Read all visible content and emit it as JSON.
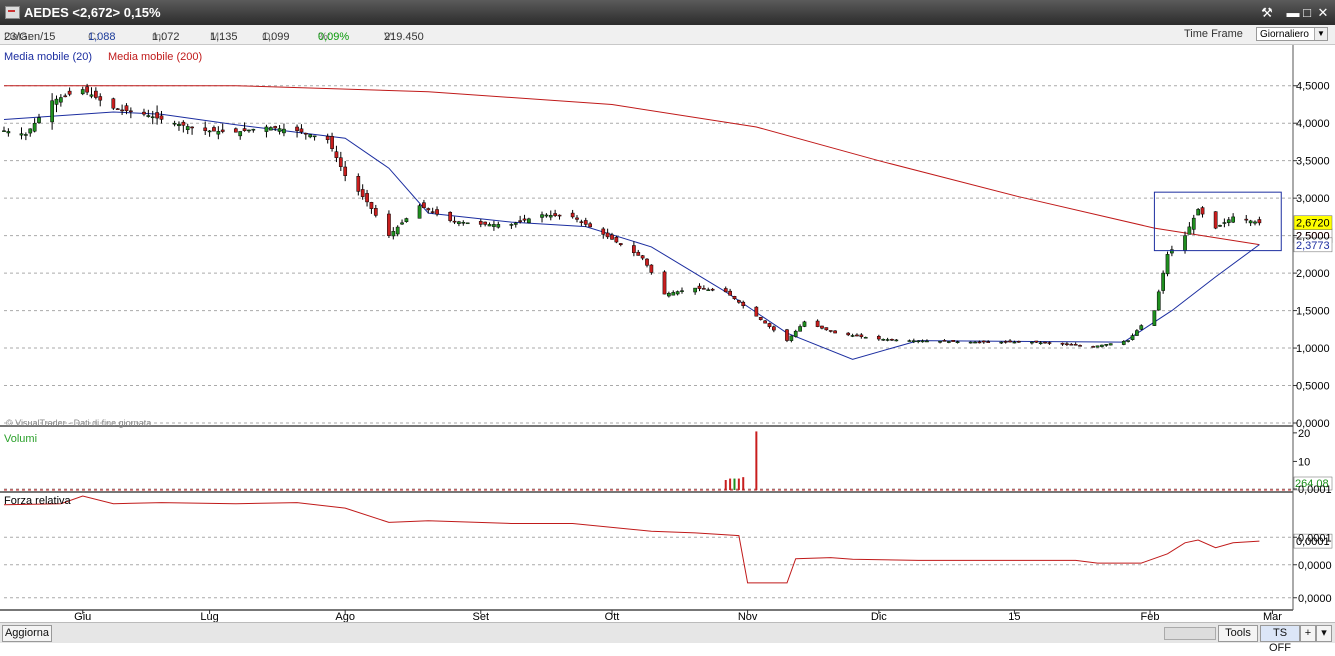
{
  "window": {
    "title": "AEDES <2,672> 0,15%"
  },
  "info": {
    "data_label": "Data:",
    "data_value": "23/Gen/15",
    "c_label": "C:",
    "c_value": "1,088",
    "m_label": "m:",
    "m_value": "1,072",
    "M_label": "M:",
    "M_value": "1,135",
    "o_label": "O:",
    "o_value": "1,099",
    "pct_label": "%:",
    "pct_value": "0,09%",
    "v_label": "V:",
    "v_value": "219.450",
    "timeframe_label": "Time Frame",
    "timeframe_value": "Giornaliero"
  },
  "bottom": {
    "aggiorna": "Aggiorna",
    "tools": "Tools",
    "ts_off": "TS OFF",
    "plus": "+",
    "menu": "▾"
  },
  "colors": {
    "up": "#1f8f1f",
    "down": "#c81e1e",
    "ma20": "#1c2ea0",
    "ma200": "#c01a1a",
    "price_badge": "#ffff00"
  },
  "chart_data": [
    {
      "type": "candlestick",
      "legend": [
        "Media mobile (20)",
        "Media mobile (200)"
      ],
      "watermark": "© VisualTrader - Dati di fine giornata",
      "x_labels": [
        "Giu",
        "Lug",
        "Ago",
        "Set",
        "Ott",
        "Nov",
        "Dic",
        "15",
        "Feb",
        "Mar"
      ],
      "y_ticks": [
        "0,0000",
        "0,5000",
        "1,0000",
        "1,5000",
        "2,0000",
        "2,5000",
        "3,0000",
        "3,5000",
        "4,0000",
        "4,5000"
      ],
      "ylim": [
        0,
        4.75
      ],
      "last_price": "2,6720",
      "ma200_last": "2,5000",
      "ma20_last": "2,3773",
      "x_start": "2014-05-15",
      "x_end": "2015-03-05",
      "close_path": [
        [
          "2014-05-15",
          3.9
        ],
        [
          "2014-05-20",
          3.85
        ],
        [
          "2014-05-26",
          4.3
        ],
        [
          "2014-06-02",
          4.45
        ],
        [
          "2014-06-09",
          4.2
        ],
        [
          "2014-06-16",
          4.12
        ],
        [
          "2014-06-23",
          4.0
        ],
        [
          "2014-06-30",
          3.9
        ],
        [
          "2014-07-07",
          3.88
        ],
        [
          "2014-07-14",
          3.95
        ],
        [
          "2014-07-21",
          3.9
        ],
        [
          "2014-07-28",
          3.78
        ],
        [
          "2014-08-01",
          3.3
        ],
        [
          "2014-08-06",
          2.95
        ],
        [
          "2014-08-11",
          2.5
        ],
        [
          "2014-08-18",
          2.9
        ],
        [
          "2014-08-25",
          2.7
        ],
        [
          "2014-09-01",
          2.65
        ],
        [
          "2014-09-08",
          2.65
        ],
        [
          "2014-09-15",
          2.78
        ],
        [
          "2014-09-22",
          2.75
        ],
        [
          "2014-10-01",
          2.45
        ],
        [
          "2014-10-08",
          2.2
        ],
        [
          "2014-10-13",
          1.72
        ],
        [
          "2014-10-20",
          1.8
        ],
        [
          "2014-10-27",
          1.75
        ],
        [
          "2014-11-10",
          1.1
        ],
        [
          "2014-11-14",
          1.35
        ],
        [
          "2014-11-21",
          1.2
        ],
        [
          "2014-12-01",
          1.12
        ],
        [
          "2014-12-08",
          1.1
        ],
        [
          "2014-12-22",
          1.08
        ],
        [
          "2015-01-05",
          1.08
        ],
        [
          "2015-01-19",
          1.02
        ],
        [
          "2015-01-27",
          1.1
        ],
        [
          "2015-02-02",
          1.5
        ],
        [
          "2015-02-05",
          2.25
        ],
        [
          "2015-02-09",
          2.5
        ],
        [
          "2015-02-12",
          2.85
        ],
        [
          "2015-02-16",
          2.6
        ],
        [
          "2015-02-20",
          2.75
        ],
        [
          "2015-02-26",
          2.67
        ]
      ],
      "ma20": [
        [
          "2014-05-15",
          4.05
        ],
        [
          "2014-06-09",
          4.15
        ],
        [
          "2014-06-20",
          4.12
        ],
        [
          "2014-07-07",
          3.98
        ],
        [
          "2014-08-01",
          3.8
        ],
        [
          "2014-08-11",
          3.4
        ],
        [
          "2014-08-20",
          2.8
        ],
        [
          "2014-09-08",
          2.68
        ],
        [
          "2014-09-25",
          2.62
        ],
        [
          "2014-10-10",
          2.35
        ],
        [
          "2014-10-27",
          1.75
        ],
        [
          "2014-11-10",
          1.2
        ],
        [
          "2014-11-25",
          0.85
        ],
        [
          "2014-12-10",
          1.1
        ],
        [
          "2015-01-26",
          1.08
        ],
        [
          "2015-02-06",
          1.5
        ],
        [
          "2015-02-16",
          1.95
        ],
        [
          "2015-02-26",
          2.38
        ]
      ],
      "ma200": [
        [
          "2014-05-15",
          4.5
        ],
        [
          "2014-07-07",
          4.5
        ],
        [
          "2014-08-20",
          4.42
        ],
        [
          "2014-10-01",
          4.25
        ],
        [
          "2014-11-03",
          3.95
        ],
        [
          "2014-12-01",
          3.5
        ],
        [
          "2015-01-02",
          3.02
        ],
        [
          "2015-02-02",
          2.6
        ],
        [
          "2015-02-26",
          2.38
        ]
      ]
    },
    {
      "type": "bar",
      "title": "Volumi",
      "y_ticks": [
        "20",
        "10"
      ],
      "ylim": [
        0,
        21
      ],
      "last_value": "264.08",
      "bars": [
        [
          "2014-10-27",
          3.5,
          "down"
        ],
        [
          "2014-10-28",
          4.0,
          "down"
        ],
        [
          "2014-10-29",
          4.0,
          "up"
        ],
        [
          "2014-10-30",
          4.0,
          "down"
        ],
        [
          "2014-10-31",
          4.5,
          "down"
        ],
        [
          "2014-11-03",
          20.5,
          "down"
        ]
      ]
    },
    {
      "type": "line",
      "title": "Forza relativa",
      "y_ticks": [
        "0,0001",
        "0,0001",
        "0,0000",
        "0,0000"
      ],
      "last_value": "0,0001",
      "series": [
        [
          "2014-05-15",
          0.84
        ],
        [
          "2014-05-28",
          0.86
        ],
        [
          "2014-06-02",
          1.0
        ],
        [
          "2014-06-09",
          0.86
        ],
        [
          "2014-06-20",
          0.88
        ],
        [
          "2014-07-07",
          0.86
        ],
        [
          "2014-07-21",
          0.88
        ],
        [
          "2014-08-01",
          0.78
        ],
        [
          "2014-08-11",
          0.52
        ],
        [
          "2014-08-20",
          0.55
        ],
        [
          "2014-09-08",
          0.5
        ],
        [
          "2014-09-22",
          0.5
        ],
        [
          "2014-10-10",
          0.36
        ],
        [
          "2014-10-20",
          0.33
        ],
        [
          "2014-10-30",
          0.28
        ],
        [
          "2014-11-01",
          -0.58
        ],
        [
          "2014-11-10",
          -0.58
        ],
        [
          "2014-11-12",
          -0.14
        ],
        [
          "2014-11-20",
          -0.12
        ],
        [
          "2014-11-25",
          -0.15
        ],
        [
          "2014-12-10",
          -0.17
        ],
        [
          "2015-01-15",
          -0.17
        ],
        [
          "2015-01-20",
          -0.22
        ],
        [
          "2015-01-30",
          -0.22
        ],
        [
          "2015-02-05",
          -0.05
        ],
        [
          "2015-02-09",
          0.15
        ],
        [
          "2015-02-12",
          0.2
        ],
        [
          "2015-02-16",
          0.06
        ],
        [
          "2015-02-20",
          0.15
        ],
        [
          "2015-02-26",
          0.18
        ]
      ]
    }
  ]
}
